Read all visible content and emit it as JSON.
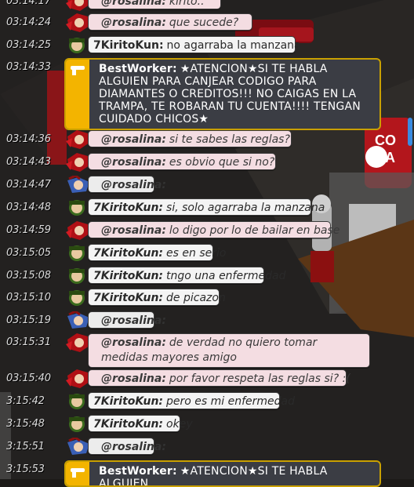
{
  "messages": [
    {
      "time": "03:14:17",
      "user": "@rosalina:",
      "text": "kirito..",
      "style": "pink",
      "avatar": "rosalina"
    },
    {
      "time": "03:14:24",
      "user": "@rosalina:",
      "text": "que sucede?",
      "style": "pink",
      "avatar": "rosalina"
    },
    {
      "time": "03:14:25",
      "user": "7KiritoKun:",
      "text": "no agarraba la manzana",
      "style": "white-plain",
      "avatar": "kirito"
    },
    {
      "time": "03:14:33",
      "user": "BestWorker:",
      "text": "★ATENCION★SI TE HABLA ALGUIEN PARA CANJEAR CODIGO PARA DIAMANTES O CREDITOS!!! NO CAIGAS EN LA TRAMPA, TE ROBARAN TU CUENTA!!!! TENGAN CUIDADO CHICOS★",
      "style": "staff",
      "avatar": "staff"
    },
    {
      "time": "03:14:36",
      "user": "@rosalina:",
      "text": "si te sabes las reglas?",
      "style": "pink",
      "avatar": "rosalina"
    },
    {
      "time": "03:14:43",
      "user": "@rosalina:",
      "text": "es obvio que si no?",
      "style": "pink",
      "avatar": "rosalina"
    },
    {
      "time": "03:14:47",
      "user": "@rosalina:",
      "text": "",
      "style": "grey",
      "avatar": "rosalina2"
    },
    {
      "time": "03:14:48",
      "user": "7KiritoKun:",
      "text": "si, solo agarraba la manzana",
      "style": "white",
      "avatar": "kirito"
    },
    {
      "time": "03:14:59",
      "user": "@rosalina:",
      "text": "lo digo por lo de bailar en base",
      "style": "pink",
      "avatar": "rosalina"
    },
    {
      "time": "03:15:05",
      "user": "7KiritoKun:",
      "text": "es en serio",
      "style": "white",
      "avatar": "kirito"
    },
    {
      "time": "03:15:08",
      "user": "7KiritoKun:",
      "text": "tngo una enfermedad",
      "style": "white",
      "avatar": "kirito"
    },
    {
      "time": "03:15:10",
      "user": "7KiritoKun:",
      "text": "de picazon",
      "style": "white",
      "avatar": "kirito"
    },
    {
      "time": "03:15:19",
      "user": "@rosalina:",
      "text": "",
      "style": "grey",
      "avatar": "rosalina2"
    },
    {
      "time": "03:15:31",
      "user": "@rosalina:",
      "text": "de verdad no quiero tomar medidas mayores amigo",
      "style": "pink",
      "avatar": "rosalina"
    },
    {
      "time": "03:15:40",
      "user": "@rosalina:",
      "text": "por favor respeta las reglas si? :(",
      "style": "pink",
      "avatar": "rosalina"
    },
    {
      "time": "3:15:42",
      "user": "7KiritoKun:",
      "text": "pero es mi enfermedad",
      "style": "white",
      "avatar": "kirito"
    },
    {
      "time": "3:15:48",
      "user": "7KiritoKun:",
      "text": "okey",
      "style": "white",
      "avatar": "kirito"
    },
    {
      "time": "3:15:51",
      "user": "@rosalina:",
      "text": "",
      "style": "grey",
      "avatar": "rosalina2"
    },
    {
      "time": "3:15:53",
      "user": "BestWorker:",
      "text": "★ATENCION★SI TE HABLA ALGUIEN",
      "style": "staff",
      "avatar": "staff"
    }
  ],
  "room_sign": "CO CA",
  "colors": {
    "pink": "#f4dde2",
    "white": "#f4f4f4",
    "staff_bg": "#3b3d44",
    "staff_stripe": "#f3b400",
    "scroll": "#3a8be0"
  }
}
